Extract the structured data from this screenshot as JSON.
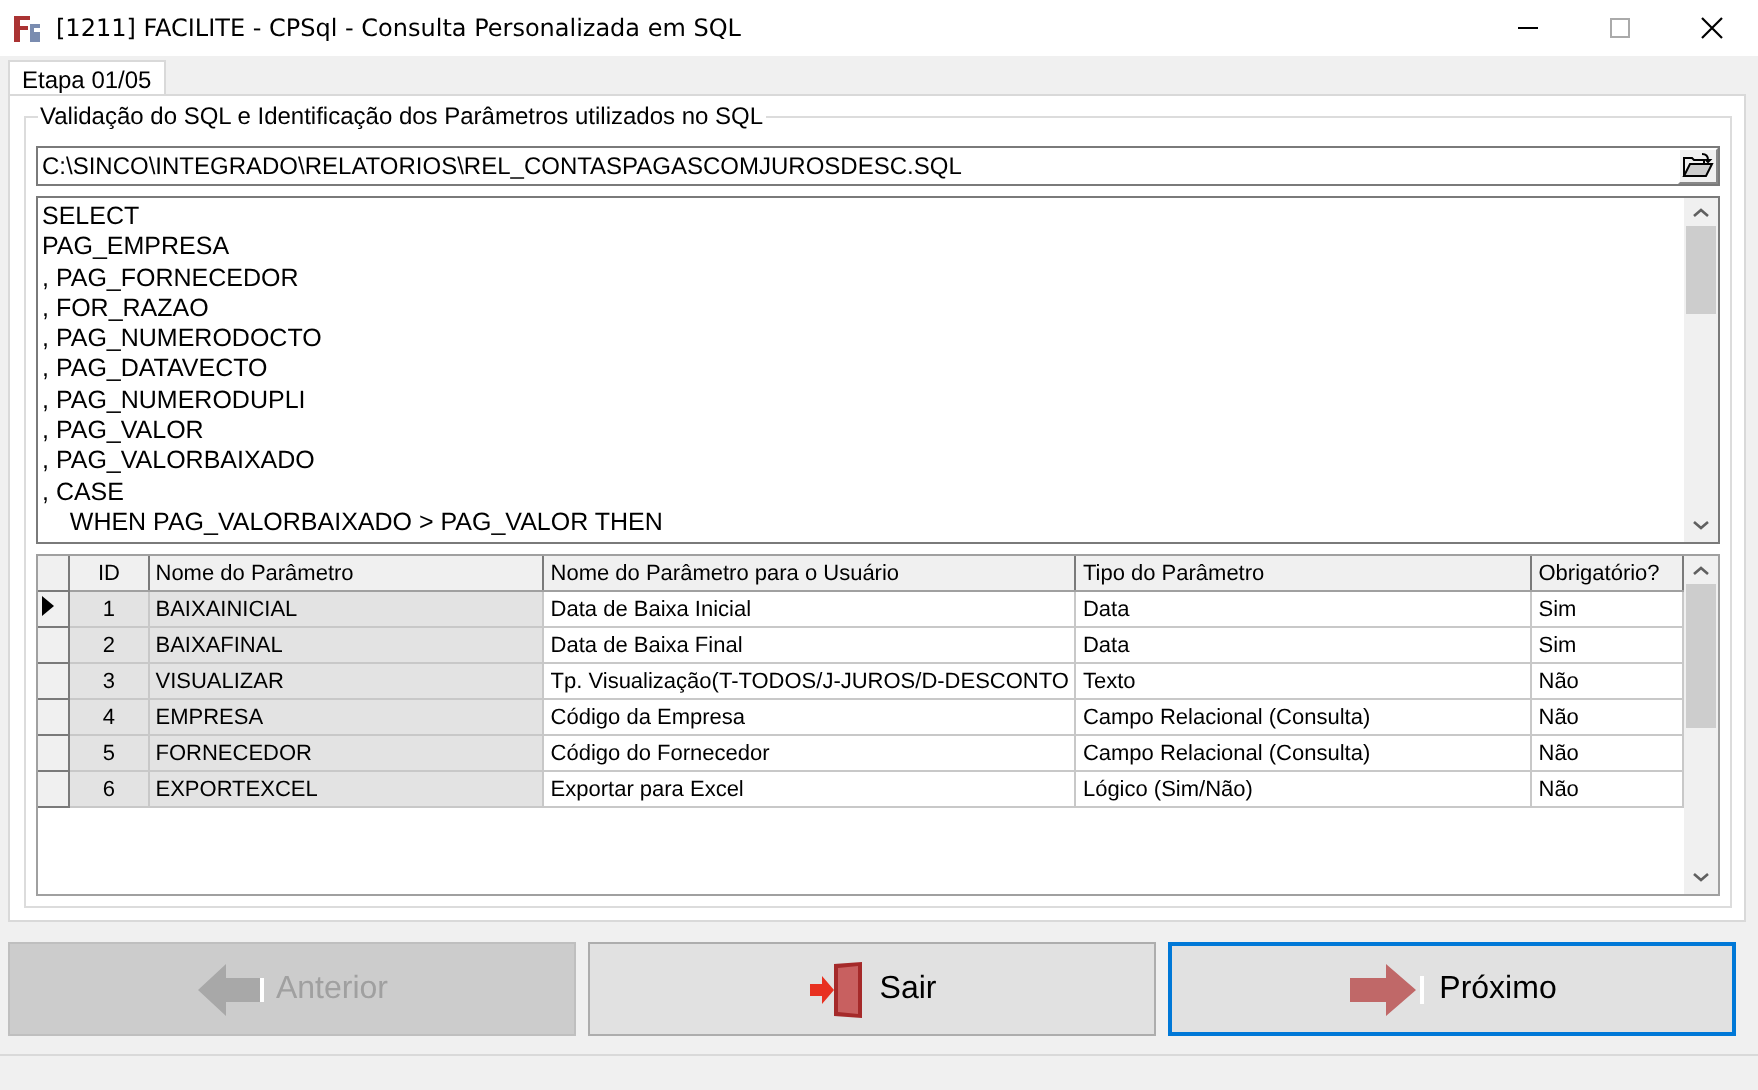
{
  "window": {
    "title": "[1211] FACILITE - CPSql - Consulta Personalizada em SQL"
  },
  "tabs": [
    {
      "label": "Etapa 01/05",
      "selected": true
    }
  ],
  "group": {
    "title": "Validação do SQL e Identificação dos Parâmetros utilizados no SQL"
  },
  "file_path": {
    "value": "C:\\SINCO\\INTEGRADO\\RELATORIOS\\REL_CONTASPAGASCOMJUROSDESC.SQL"
  },
  "sql_lines": [
    "SELECT",
    "PAG_EMPRESA",
    ", PAG_FORNECEDOR",
    ", FOR_RAZAO",
    ", PAG_NUMERODOCTO",
    ", PAG_DATAVECTO",
    ", PAG_NUMERODUPLI",
    ", PAG_VALOR",
    ", PAG_VALORBAIXADO",
    ", CASE",
    "    WHEN PAG_VALORBAIXADO > PAG_VALOR THEN"
  ],
  "table": {
    "columns": [
      "ID",
      "Nome do Parâmetro",
      "Nome do Parâmetro para o Usuário",
      "Tipo do Parâmetro",
      "Obrigatório?"
    ],
    "rows": [
      {
        "selected": true,
        "cells": [
          "1",
          "BAIXAINICIAL",
          "Data de Baixa Inicial",
          "Data",
          "Sim"
        ]
      },
      {
        "selected": false,
        "cells": [
          "2",
          "BAIXAFINAL",
          "Data de Baixa Final",
          "Data",
          "Sim"
        ]
      },
      {
        "selected": false,
        "cells": [
          "3",
          "VISUALIZAR",
          "Tp. Visualização(T-TODOS/J-JUROS/D-DESCONTO",
          "Texto",
          "Não"
        ]
      },
      {
        "selected": false,
        "cells": [
          "4",
          "EMPRESA",
          "Código da Empresa",
          "Campo Relacional (Consulta)",
          "Não"
        ]
      },
      {
        "selected": false,
        "cells": [
          "5",
          "FORNECEDOR",
          "Código do Fornecedor",
          "Campo Relacional (Consulta)",
          "Não"
        ]
      },
      {
        "selected": false,
        "cells": [
          "6",
          "EXPORTEXCEL",
          "Exportar para Excel",
          "Lógico (Sim/Não)",
          "Não"
        ]
      }
    ]
  },
  "buttons": [
    {
      "kind": "back",
      "label": "Anterior",
      "disabled": true,
      "focused": false
    },
    {
      "kind": "exit",
      "label": "Sair",
      "disabled": false,
      "focused": false
    },
    {
      "kind": "next",
      "label": "Próximo",
      "disabled": false,
      "focused": true
    }
  ]
}
